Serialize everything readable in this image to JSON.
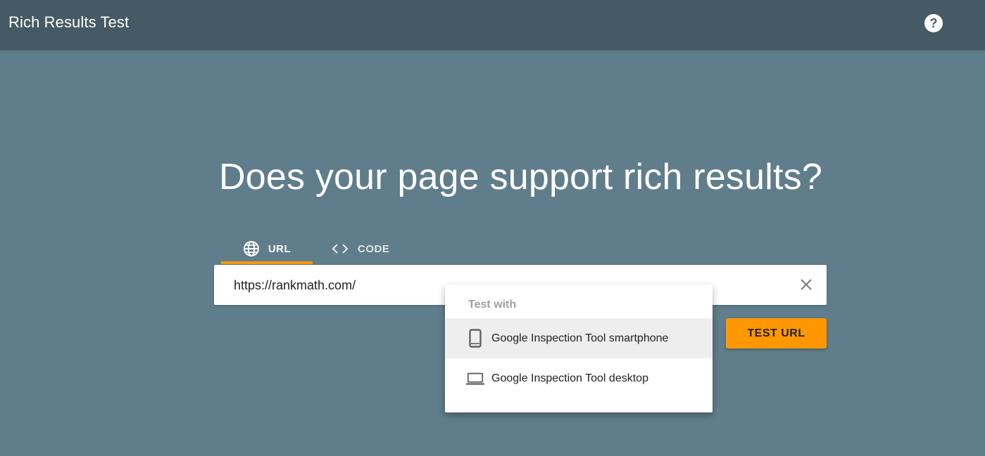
{
  "app": {
    "title": "Rich Results Test",
    "help_icon": "help-icon"
  },
  "main": {
    "headline": "Does your page support rich results?",
    "tabs": [
      {
        "label": "URL",
        "icon": "globe-icon",
        "active": true
      },
      {
        "label": "CODE",
        "icon": "code-icon",
        "active": false
      }
    ],
    "url_input": {
      "value": "https://rankmath.com/"
    },
    "test_button_label": "TEST URL"
  },
  "menu": {
    "header": "Test with",
    "items": [
      {
        "label": "Google Inspection Tool smartphone",
        "icon": "smartphone-icon",
        "selected": true
      },
      {
        "label": "Google Inspection Tool desktop",
        "icon": "laptop-icon",
        "selected": false
      }
    ]
  },
  "colors": {
    "appbar": "#455a64",
    "background": "#607d8b",
    "accent": "#ff9800"
  }
}
